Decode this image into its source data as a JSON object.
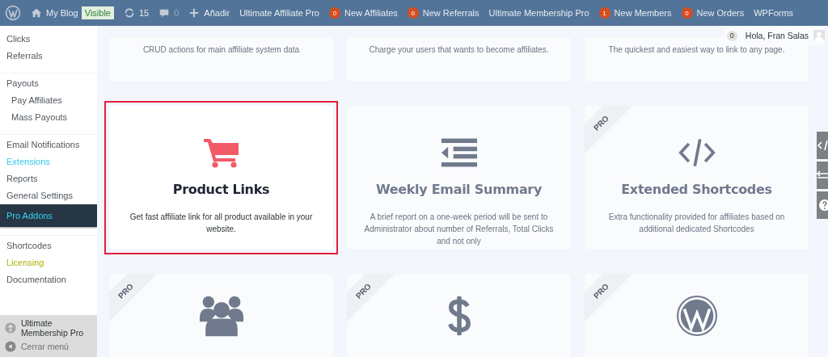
{
  "admin_bar": {
    "site": "My Blog",
    "visibility": "Visible",
    "updates": "15",
    "comments": "0",
    "add": "Añadir",
    "menus": [
      {
        "label": "Ultimate Affiliate Pro"
      },
      {
        "label": "New Affiliates",
        "count": "0"
      },
      {
        "label": "New Referrals",
        "count": "0"
      },
      {
        "label": "Ultimate Membership Pro"
      },
      {
        "label": "New Members",
        "count": "1"
      },
      {
        "label": "New Orders",
        "count": "0"
      },
      {
        "label": "WPForms"
      }
    ],
    "user": {
      "greeting": "Hola, Fran Salas",
      "notifications": "0"
    }
  },
  "sidebar": {
    "groups": [
      [
        {
          "label": "Clicks",
          "selected": false
        },
        {
          "label": "Referrals",
          "selected": false
        }
      ],
      [
        {
          "label": "Payouts",
          "selected": false,
          "children": [
            {
              "label": "Pay Affiliates",
              "selected": false
            },
            {
              "label": "Mass Payouts",
              "selected": false
            }
          ]
        }
      ],
      [
        {
          "label": "Email Notifications",
          "selected": false
        },
        {
          "label": "Extensions",
          "selected": false,
          "color": "#2ec8e4"
        },
        {
          "label": "Reports",
          "selected": false
        },
        {
          "label": "General Settings",
          "selected": false
        },
        {
          "label": "Pro Addons",
          "selected": true
        }
      ],
      [
        {
          "label": "Shortcodes",
          "selected": false
        },
        {
          "label": "Licensing",
          "selected": false,
          "color": "#a9b000"
        },
        {
          "label": "Documentation",
          "selected": false
        }
      ]
    ],
    "footer": {
      "plugin": "Ultimate Membership Pro",
      "collapse": "Cerrar menú"
    }
  },
  "addons": [
    {
      "description": "CRUD actions for main affiliate system data",
      "selected": false
    },
    {
      "description": "Charge your users that wants to become affiliates.",
      "selected": false
    },
    {
      "description": "The quickest and easiest way to link to any page.",
      "selected": false
    },
    {
      "title": "Product Links",
      "description": "Get fast affiliate link for all product available in your website.",
      "selected": true
    },
    {
      "title": "Weekly Email Summary",
      "description": "A brief report on a one-week period will be sent to Administrator about number of Referrals, Total Clicks and not only",
      "selected": false
    },
    {
      "title": "Extended Shortcodes",
      "description": "Extra functionality provided for affiliates based on additional dedicated Shortcodes",
      "badge": "PRO",
      "selected": false
    },
    {
      "badge": "PRO",
      "selected": false
    },
    {
      "badge": "PRO",
      "selected": false
    },
    {
      "badge": "PRO",
      "selected": false
    }
  ]
}
